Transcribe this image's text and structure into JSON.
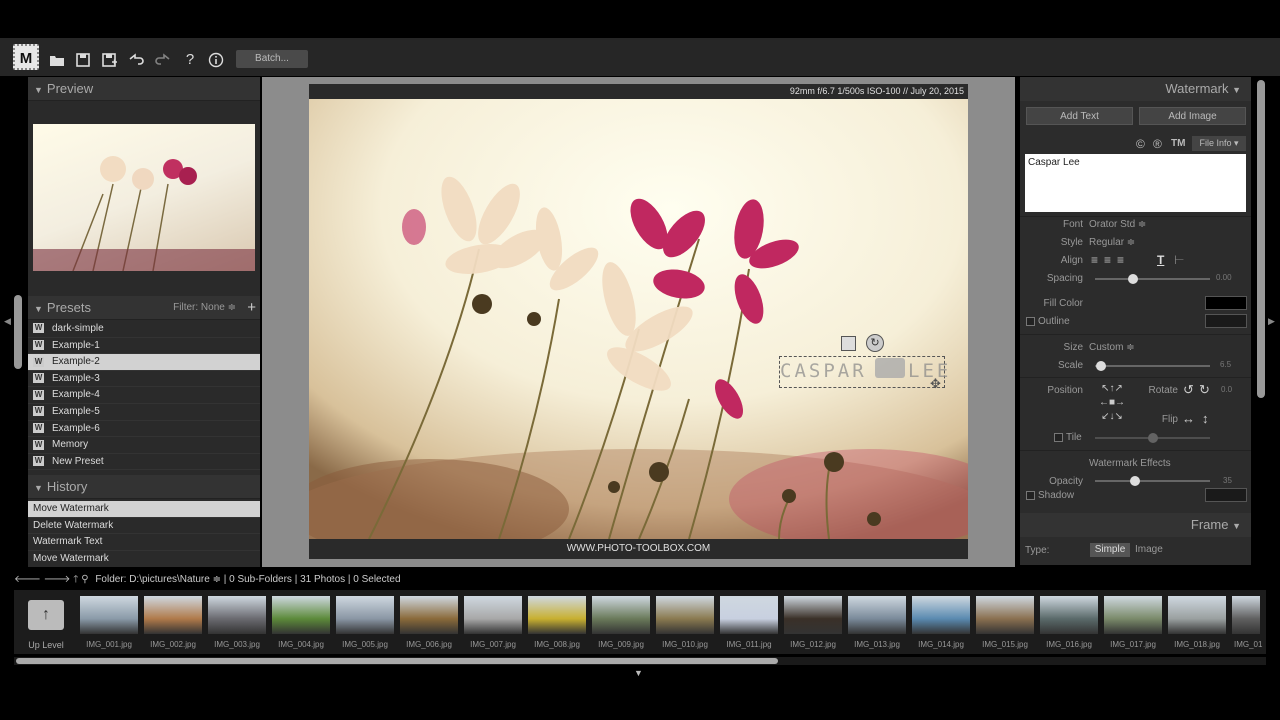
{
  "toolbar": {
    "logo": "M",
    "batch_label": "Batch...",
    "icons": [
      "folder-open-icon",
      "save-icon",
      "save-as-icon",
      "undo-icon",
      "redo-icon",
      "help-icon",
      "info-icon"
    ]
  },
  "preview": {
    "title": "Preview"
  },
  "presets": {
    "title": "Presets",
    "filter_label": "Filter: None ≑",
    "items": [
      "dark-simple",
      "Example-1",
      "Example-2",
      "Example-3",
      "Example-4",
      "Example-5",
      "Example-6",
      "Memory",
      "New Preset"
    ],
    "selected_index": 2
  },
  "history": {
    "title": "History",
    "items": [
      "Move Watermark",
      "Delete Watermark",
      "Watermark Text",
      "Move Watermark"
    ],
    "selected_index": 0
  },
  "photo": {
    "exif": "92mm f/6.7 1/500s ISO-100 // July 20, 2015",
    "footer": "WWW.PHOTO-TOOLBOX.COM",
    "watermark_left": "CASPAR",
    "watermark_right": "LEE"
  },
  "watermark_panel": {
    "title": "Watermark",
    "add_text": "Add Text",
    "add_image": "Add Image",
    "file_info": "File Info ▾",
    "text_value": "Caspar  Lee",
    "font_label": "Font",
    "font_value": "Orator Std ≑",
    "style_label": "Style",
    "style_value": "Regular ≑",
    "align_label": "Align",
    "spacing_label": "Spacing",
    "spacing_value": "0.00",
    "fill_color_label": "Fill Color",
    "outline_label": "Outline",
    "size_label": "Size",
    "size_value": "Custom ≑",
    "scale_label": "Scale",
    "scale_value": "6.5",
    "position_label": "Position",
    "rotate_label": "Rotate",
    "rotate_value": "0.0",
    "flip_label": "Flip",
    "tile_label": "Tile",
    "effects_title": "Watermark Effects",
    "opacity_label": "Opacity",
    "opacity_value": "35",
    "shadow_label": "Shadow",
    "colors": {
      "fill": "#000000",
      "outline": "#000000",
      "shadow": "#1a1a1a"
    }
  },
  "frame_panel": {
    "title": "Frame",
    "type_label": "Type:",
    "simple": "Simple",
    "image": "Image"
  },
  "folder_bar": {
    "text": "Folder:  D:\\pictures\\Nature ≑ | 0 Sub-Folders | 31 Photos | 0 Selected"
  },
  "filmstrip": {
    "up_level": "Up Level",
    "files": [
      "IMG_001.jpg",
      "IMG_002.jpg",
      "IMG_003.jpg",
      "IMG_004.jpg",
      "IMG_005.jpg",
      "IMG_006.jpg",
      "IMG_007.jpg",
      "IMG_008.jpg",
      "IMG_009.jpg",
      "IMG_010.jpg",
      "IMG_011.jpg",
      "IMG_012.jpg",
      "IMG_013.jpg",
      "IMG_014.jpg",
      "IMG_015.jpg",
      "IMG_016.jpg",
      "IMG_017.jpg",
      "IMG_018.jpg",
      "IMG_01"
    ],
    "thumb_colors": [
      "#8a9aa8",
      "#b07a4a",
      "#6a6a70",
      "#5c8a3a",
      "#8a96a4",
      "#8a6a3a",
      "#a8a8a8",
      "#c8b030",
      "#6a7a5a",
      "#8a7a50",
      "#c8d0e0",
      "#3a3028",
      "#7a8a9a",
      "#5a8ab0",
      "#8a7050",
      "#5a6a6a",
      "#7a8a6a",
      "#9aa0a0",
      "#606060"
    ]
  }
}
